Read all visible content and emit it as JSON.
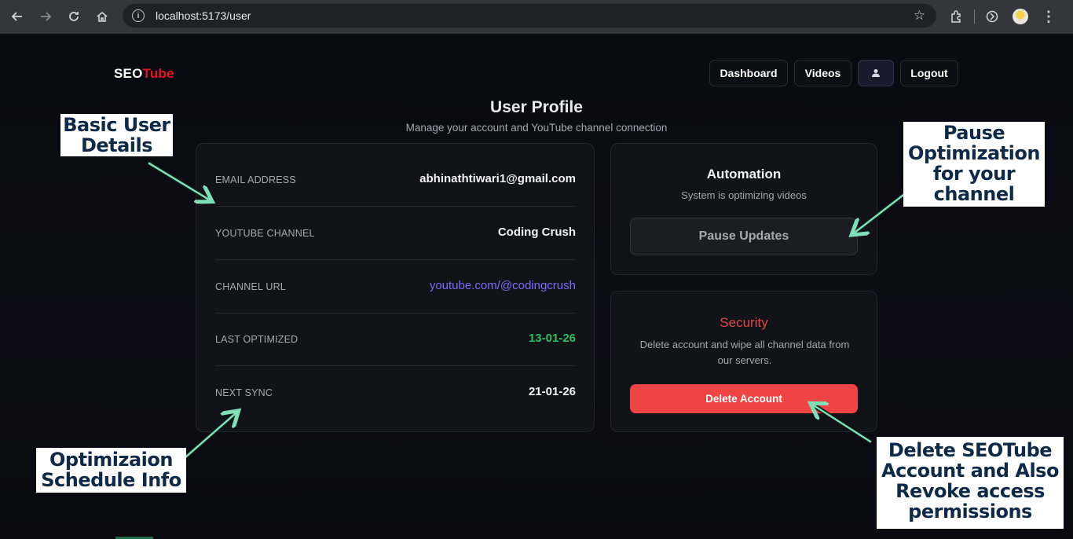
{
  "browser": {
    "url": "localhost:5173/user",
    "icons": [
      "back-arrow-icon",
      "forward-arrow-icon",
      "reload-icon",
      "home-icon",
      "site-info-icon",
      "bookmark-star-icon",
      "extensions-icon",
      "sync-icon",
      "profile-avatar",
      "kebab-menu-icon"
    ]
  },
  "header": {
    "logo_seo": "SEO",
    "logo_tube": "Tube",
    "nav": {
      "dashboard": "Dashboard",
      "videos": "Videos",
      "logout": "Logout"
    }
  },
  "page": {
    "title": "User Profile",
    "subtitle": "Manage your account and YouTube channel connection"
  },
  "details": [
    {
      "label": "EMAIL ADDRESS",
      "value": "abhinathtiwari1@gmail.com"
    },
    {
      "label": "YOUTUBE CHANNEL",
      "value": "Coding Crush"
    },
    {
      "label": "CHANNEL URL",
      "value": "youtube.com/@codingcrush"
    },
    {
      "label": "LAST OPTIMIZED",
      "value": "13-01-26"
    },
    {
      "label": "NEXT SYNC",
      "value": "21-01-26"
    }
  ],
  "automation": {
    "title": "Automation",
    "status": "System is optimizing videos",
    "button": "Pause Updates"
  },
  "security": {
    "title": "Security",
    "description": "Delete account and wipe all channel data from our servers.",
    "button": "Delete Account"
  },
  "annotations": {
    "basic": [
      "Basic User",
      "Details"
    ],
    "pause": [
      "Pause",
      "Optimization",
      "for your",
      "channel"
    ],
    "schedule": [
      "Optimizaion",
      "Schedule Info"
    ],
    "delete": [
      "Delete SEOTube",
      "Account and Also",
      "Revoke access",
      "permissions"
    ]
  },
  "colors": {
    "brand_red": "#e8141e",
    "link_purple": "#7b6cf6",
    "date_green": "#2fbf5e",
    "danger": "#ef4444",
    "annotation_text": "#0e2a47",
    "arrow": "#7fe0b8"
  }
}
